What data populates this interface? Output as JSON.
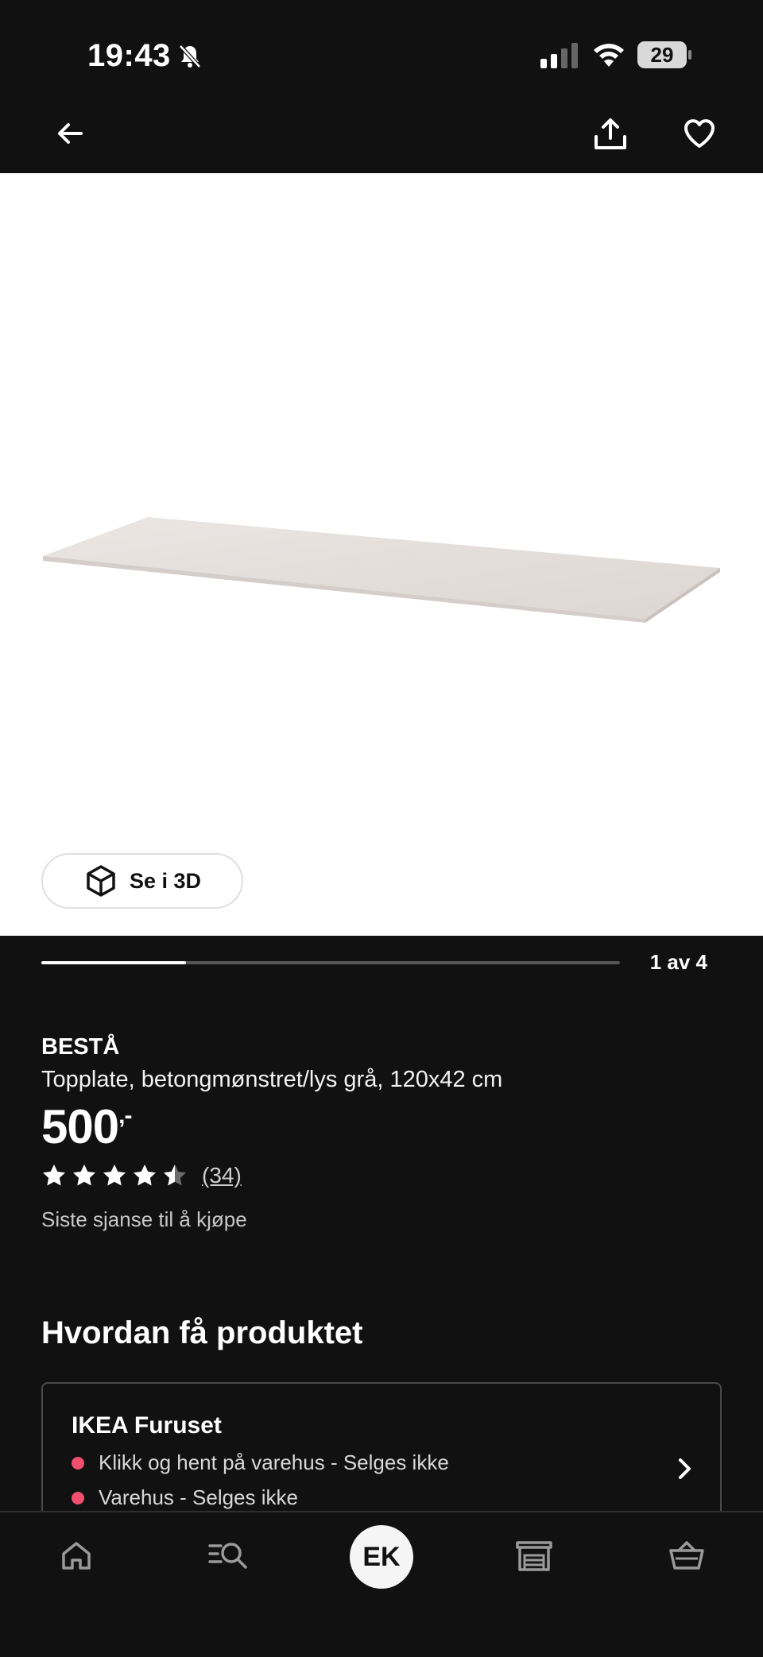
{
  "status_bar": {
    "time": "19:43",
    "battery": "29"
  },
  "nav": {
    "back_icon": "arrow-left-icon",
    "share_icon": "share-icon",
    "favorite_icon": "heart-icon"
  },
  "gallery": {
    "view_3d_label": "Se i 3D",
    "counter": "1 av 4",
    "current_index": 1,
    "total_images": 4
  },
  "product": {
    "brand": "BESTÅ",
    "description": "Topplate, betongmønstret/lys grå, 120x42 cm",
    "price": "500",
    "price_suffix": ",-",
    "rating": 4.5,
    "rating_max": 5,
    "review_count": "(34)",
    "availability_note": "Siste sjanse til å kjøpe"
  },
  "how_to_get": {
    "title": "Hvordan få produktet",
    "store_name": "IKEA Furuset",
    "options": [
      "Klikk og hent på varehus - Selges ikke",
      "Varehus - Selges ikke"
    ],
    "status_color": "#f0506e"
  },
  "tab_bar": {
    "profile_initials": "EK",
    "icons": [
      "home-icon",
      "search-list-icon",
      "profile-avatar",
      "store-icon",
      "basket-icon"
    ]
  }
}
